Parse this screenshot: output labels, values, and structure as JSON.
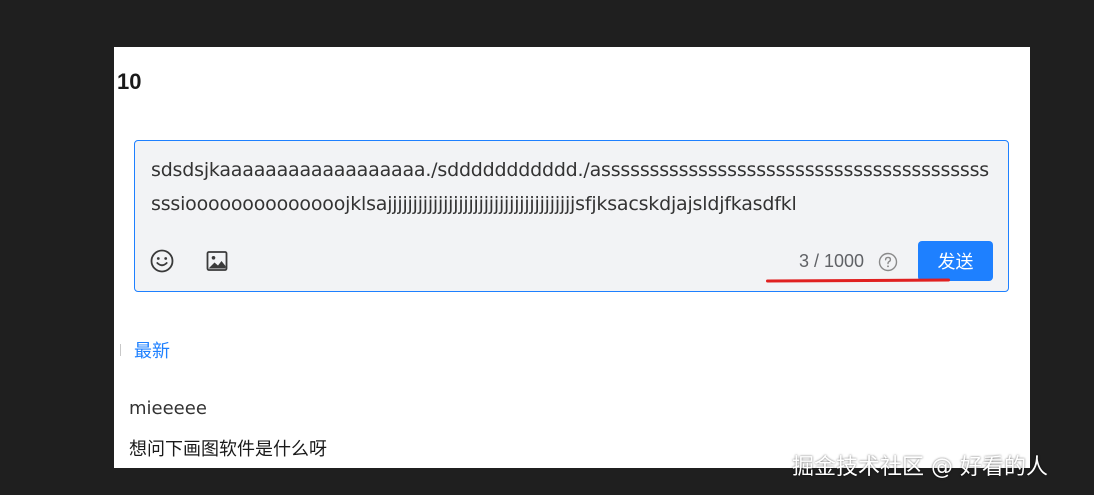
{
  "comments_section": {
    "count": "10"
  },
  "editor": {
    "text": "sdsdsjkaaaaaaaaaaaaaaaaaa./sddddddddddd./asssssssssssssssssssssssssssssssssssssssssssioooooooooooooojklsajjjjjjjjjjjjjjjjjjjjjjjjjjjjjjjjjjjjjsfjksacskdjajsldjfkasdfkl",
    "char_counter": "3 / 1000",
    "send_label": "发送",
    "icons": {
      "emoji": "smiley-icon",
      "image": "image-icon",
      "help": "question-circle-icon"
    },
    "accent_color": "#1e80ff",
    "annotation_color": "#e02020"
  },
  "tabs": {
    "latest": "最新"
  },
  "comments": [
    {
      "author": "mieeeee",
      "content": "想问下画图软件是什么呀"
    }
  ],
  "watermark": "掘金技术社区 @ 好看的人"
}
